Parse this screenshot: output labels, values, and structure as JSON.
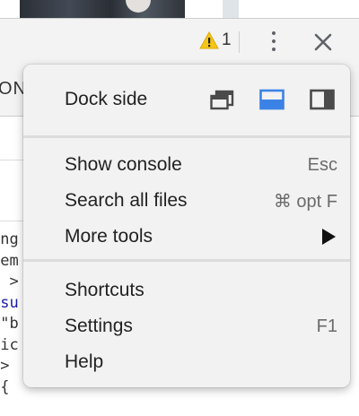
{
  "toolbar": {
    "warning_count": "1"
  },
  "background": {
    "panel_tab_fragment": "ON",
    "code_lines": [
      "ing",
      "tem",
      "{ >",
      "\"su",
      "=\"b",
      "dic",
      " >",
      " {"
    ]
  },
  "menu": {
    "dock_side_label": "Dock side",
    "dock_options": [
      {
        "name": "undock-into-separate-window",
        "selected": false
      },
      {
        "name": "dock-to-bottom",
        "selected": true
      },
      {
        "name": "dock-to-right",
        "selected": false
      }
    ],
    "items": [
      {
        "label": "Show console",
        "shortcut": "Esc"
      },
      {
        "label": "Search all files",
        "shortcut": "⌘ opt F"
      },
      {
        "label": "More tools",
        "shortcut": ""
      },
      {
        "label": "Shortcuts",
        "shortcut": ""
      },
      {
        "label": "Settings",
        "shortcut": "F1"
      },
      {
        "label": "Help",
        "shortcut": ""
      }
    ]
  },
  "colors": {
    "accent": "#3b82e6",
    "warning": "#f5c518",
    "menu_bg": "#f2f2f2"
  }
}
